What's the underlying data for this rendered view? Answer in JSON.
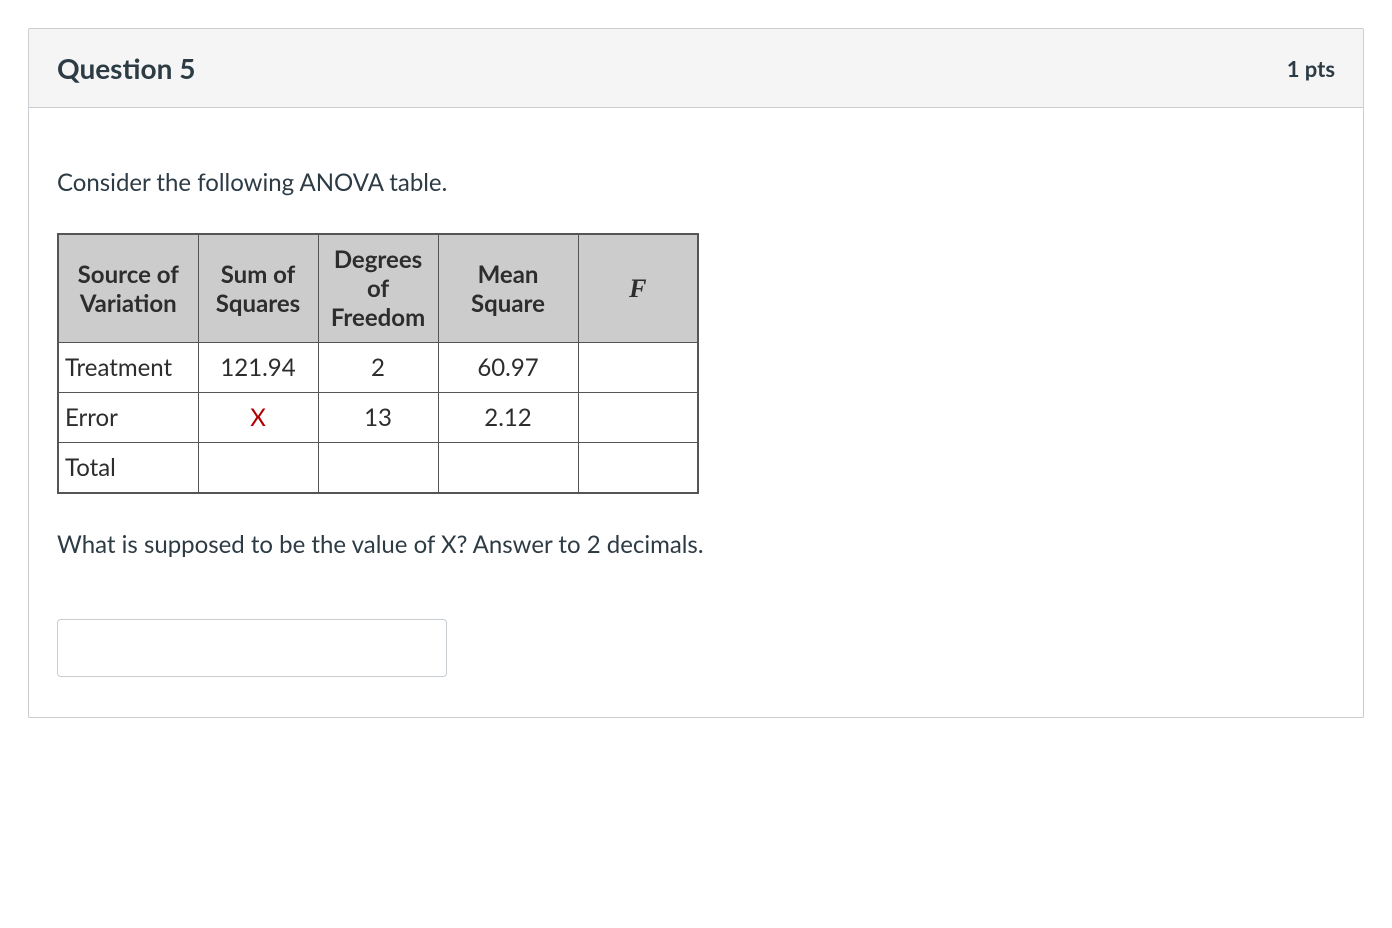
{
  "header": {
    "title": "Question 5",
    "points": "1 pts"
  },
  "body": {
    "intro": "Consider the following ANOVA table.",
    "followup": "What is supposed to be the value of X? Answer to 2 decimals.",
    "answer_value": ""
  },
  "table": {
    "headers": {
      "source": "Source of Variation",
      "ss": "Sum of Squares",
      "df": "Degrees of Freedom",
      "ms": "Mean Square",
      "f": "F"
    },
    "rows": [
      {
        "source": "Treatment",
        "ss": "121.94",
        "df": "2",
        "ms": "60.97",
        "f": "",
        "bold": false,
        "xred": false
      },
      {
        "source": "Error",
        "ss": "X",
        "df": "13",
        "ms": "2.12",
        "f": "",
        "bold": false,
        "xred": true
      },
      {
        "source": "Total",
        "ss": "",
        "df": "",
        "ms": "",
        "f": "",
        "bold": true,
        "xred": false
      }
    ]
  }
}
